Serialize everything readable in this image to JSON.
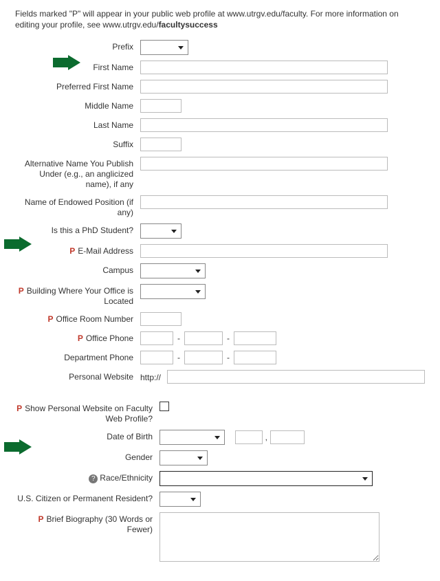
{
  "intro": {
    "text_a": "Fields marked \"P\" will appear in your public web profile at www.utrgv.edu/faculty. For more information on editing your profile, see ",
    "text_b": "www.utrgv.edu/",
    "text_c": "facultysuccess"
  },
  "p_marker": "P",
  "labels": {
    "prefix": "Prefix",
    "first_name": "First Name",
    "preferred_first_name": "Preferred First Name",
    "middle_name": "Middle Name",
    "last_name": "Last Name",
    "suffix": "Suffix",
    "alt_name": "Alternative Name You Publish Under (e.g., an anglicized name), if any",
    "endowed": "Name of Endowed Position (if any)",
    "phd": "Is this a PhD Student?",
    "email": "E-Mail Address",
    "campus": "Campus",
    "building": "Building Where Your Office is Located",
    "room": "Office Room Number",
    "office_phone": "Office Phone",
    "dept_phone": "Department Phone",
    "website": "Personal Website",
    "show_website": "Show Personal Website on Faculty Web Profile?",
    "dob": "Date of Birth",
    "gender": "Gender",
    "race": "Race/Ethnicity",
    "citizen": "U.S. Citizen or Permanent Resident?",
    "bio": "Brief Biography (30 Words or Fewer)"
  },
  "website_prefix": "http://",
  "dob_sep": ","
}
